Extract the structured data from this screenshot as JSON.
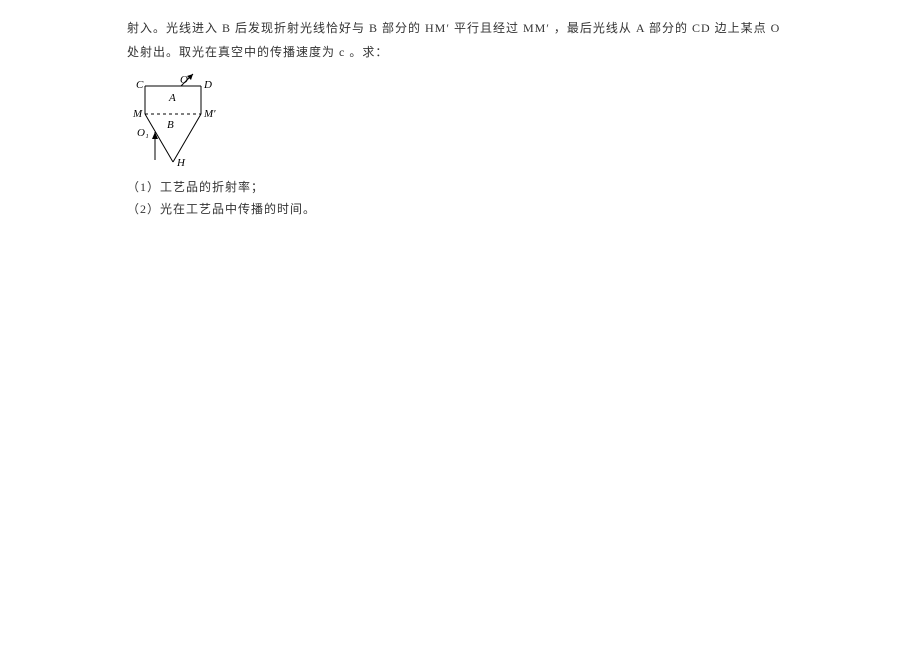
{
  "paragraph": {
    "line1": "射入。光线进入 B 后发现折射光线恰好与 B 部分的 HM′ 平行且经过 MM′ ，最后光线从 A 部分的 CD 边上某点 O",
    "line2": "处射出。取光在真空中的传播速度为 c 。求："
  },
  "figure": {
    "labels": {
      "C": "C",
      "D": "D",
      "O": "O",
      "A": "A",
      "M": "M",
      "Mp": "M′",
      "B": "B",
      "O1": "O₁",
      "H": "H"
    }
  },
  "questions": {
    "q1": "（1）工艺品的折射率；",
    "q2": "（2）光在工艺品中传播的时间。"
  }
}
